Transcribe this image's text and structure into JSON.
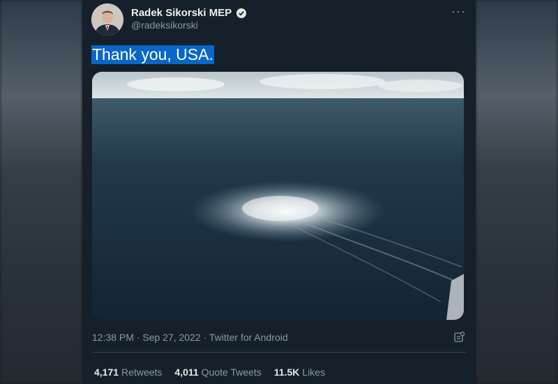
{
  "author": {
    "name": "Radek Sikorski MEP",
    "handle": "@radeksikorski",
    "verified_icon": "verified-badge-icon"
  },
  "menu": {
    "more_label": "···"
  },
  "tweet": {
    "text": "Thank you, USA.",
    "image_icon": "sea-gas-leak-photo",
    "timestamp": "12:38 PM · Sep 27, 2022 · Twitter for Android"
  },
  "stats": {
    "retweets_count": "4,171",
    "retweets_label": "Retweets",
    "quotes_count": "4,011",
    "quotes_label": "Quote Tweets",
    "likes_count": "11.5K",
    "likes_label": "Likes"
  },
  "colors": {
    "background": "#15202b",
    "selection_highlight": "#0a66c8",
    "secondary_text": "#8b98a5"
  }
}
